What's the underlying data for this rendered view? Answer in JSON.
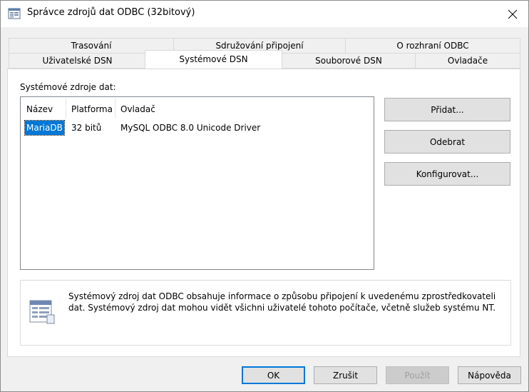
{
  "window": {
    "title": "Správce zdrojů dat ODBC (32bitový)",
    "close_glyph": "✕"
  },
  "tabs": {
    "row_back": [
      {
        "label": "Trasování"
      },
      {
        "label": "Sdružování připojení"
      },
      {
        "label": "O rozhraní ODBC"
      }
    ],
    "row_front": [
      {
        "label": "Uživatelské DSN"
      },
      {
        "label": "Systémové DSN",
        "active": true
      },
      {
        "label": "Souborové DSN"
      },
      {
        "label": "Ovladače"
      }
    ]
  },
  "datasources": {
    "group_label": "Systémové zdroje dat:",
    "columns": [
      "Název",
      "Platforma",
      "Ovladač"
    ],
    "rows": [
      {
        "name": "MariaDB",
        "platform": "32 bitů",
        "driver": "MySQL ODBC 8.0 Unicode Driver",
        "selected": true
      }
    ]
  },
  "side_buttons": {
    "add": "Přidat...",
    "remove": "Odebrat",
    "configure": "Konfigurovat..."
  },
  "info": {
    "text": "Systémový zdroj dat ODBC obsahuje informace o způsobu připojení k uvedenému zprostředkovateli dat. Systémový zdroj dat mohou vidět všichni uživatelé tohoto počítače, včetně služeb systému NT."
  },
  "footer_buttons": {
    "ok": "OK",
    "cancel": "Zrušit",
    "apply": "Použít",
    "help": "Nápověda"
  },
  "colors": {
    "selection": "#0078d7",
    "dialog_bg": "#f0f0f0",
    "panel_bg": "#ffffff"
  }
}
